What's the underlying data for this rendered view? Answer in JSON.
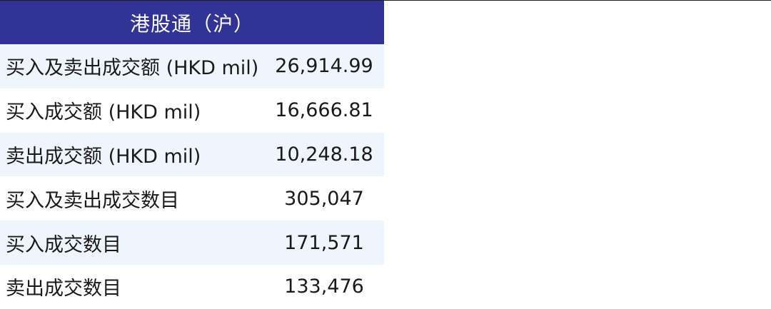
{
  "table": {
    "header": "港股通（沪）",
    "rows": [
      {
        "label": "买入及卖出成交额 (HKD mil)",
        "value": "26,914.99"
      },
      {
        "label": "买入成交额 (HKD mil)",
        "value": "16,666.81"
      },
      {
        "label": "卖出成交额 (HKD mil)",
        "value": "10,248.18"
      },
      {
        "label": "买入及卖出成交数目",
        "value": "305,047"
      },
      {
        "label": "买入成交数目",
        "value": "171,571"
      },
      {
        "label": "卖出成交数目",
        "value": "133,476"
      }
    ]
  },
  "colors": {
    "header_bg": "#313396",
    "header_text": "#ffffff",
    "shaded_row": "#eef5fd"
  }
}
